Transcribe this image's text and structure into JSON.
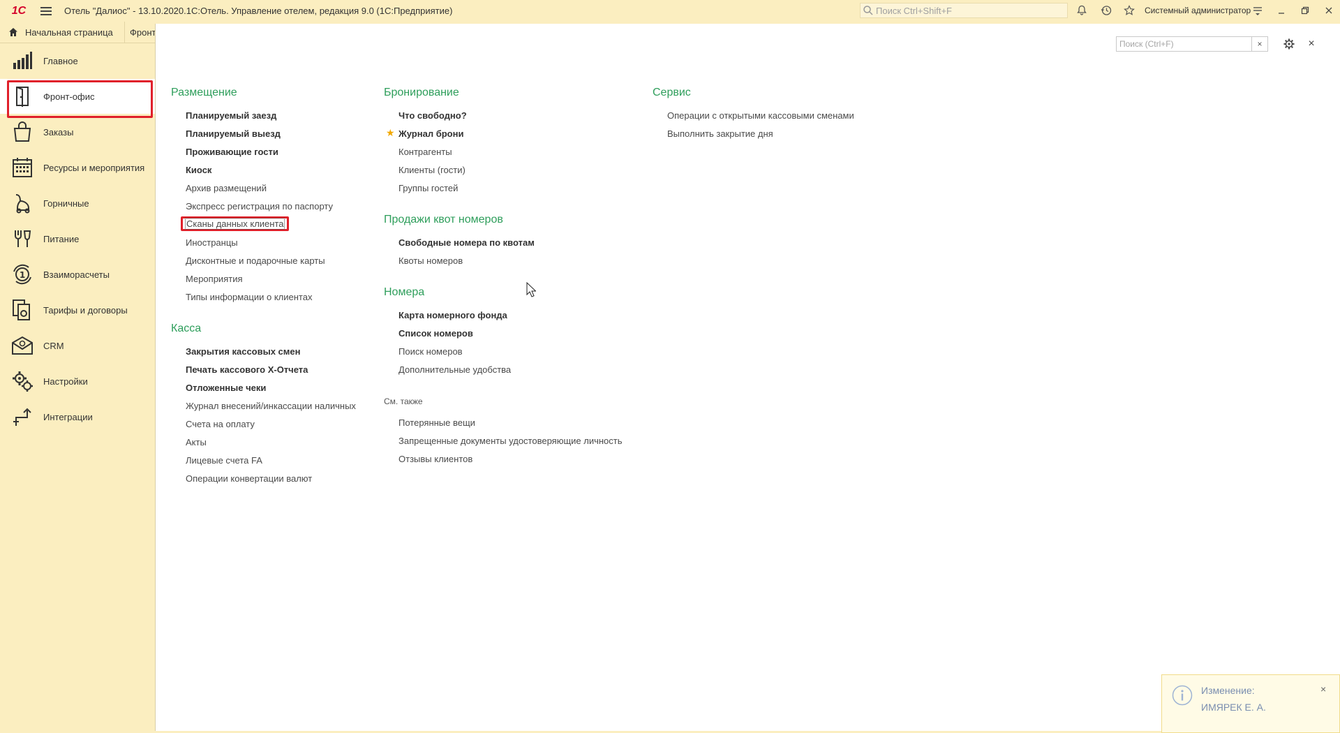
{
  "titlebar": {
    "logo": "1С",
    "title": "Отель \"Далиос\" - 13.10.2020.1С:Отель. Управление отелем, редакция 9.0  (1С:Предприятие)",
    "search_placeholder": "Поиск Ctrl+Shift+F",
    "user": "Системный администратор"
  },
  "tabs": {
    "home": "Начальная страница",
    "front": "Фронт-офис"
  },
  "sidebar": {
    "items": [
      {
        "label": "Главное",
        "icon": "bar-chart-icon"
      },
      {
        "label": "Фронт-офис",
        "icon": "door-icon",
        "active": true
      },
      {
        "label": "Заказы",
        "icon": "shopping-bag-icon"
      },
      {
        "label": "Ресурсы и мероприятия",
        "icon": "calendar-icon"
      },
      {
        "label": "Горничные",
        "icon": "vacuum-icon"
      },
      {
        "label": "Питание",
        "icon": "food-icon"
      },
      {
        "label": "Взаиморасчеты",
        "icon": "coin-cycle-icon"
      },
      {
        "label": "Тарифы и договоры",
        "icon": "documents-icon"
      },
      {
        "label": "CRM",
        "icon": "crm-mail-icon"
      },
      {
        "label": "Настройки",
        "icon": "settings-gears-icon"
      },
      {
        "label": "Интеграции",
        "icon": "integration-arrows-icon"
      }
    ]
  },
  "panel": {
    "search_placeholder": "Поиск (Ctrl+F)",
    "search_clear": "×",
    "close": "×"
  },
  "columns": {
    "placement": {
      "title": "Размещение",
      "items": [
        {
          "label": "Планируемый заезд",
          "bold": true
        },
        {
          "label": "Планируемый выезд",
          "bold": true
        },
        {
          "label": "Проживающие гости",
          "bold": true
        },
        {
          "label": "Киоск",
          "bold": true
        },
        {
          "label": "Архив размещений",
          "bold": false
        },
        {
          "label": "Экспресс регистрация по паспорту",
          "bold": false
        },
        {
          "label": "Сканы данных клиента",
          "bold": false,
          "highlighted": true
        },
        {
          "label": "Иностранцы",
          "bold": false
        },
        {
          "label": "Дисконтные и подарочные карты",
          "bold": false
        },
        {
          "label": "Мероприятия",
          "bold": false
        },
        {
          "label": "Типы информации о клиентах",
          "bold": false
        }
      ]
    },
    "cash": {
      "title": "Касса",
      "items": [
        {
          "label": "Закрытия кассовых смен",
          "bold": true
        },
        {
          "label": "Печать кассового X-Отчета",
          "bold": true
        },
        {
          "label": "Отложенные чеки",
          "bold": true
        },
        {
          "label": "Журнал внесений/инкассации наличных",
          "bold": false
        },
        {
          "label": "Счета на оплату",
          "bold": false
        },
        {
          "label": "Акты",
          "bold": false
        },
        {
          "label": "Лицевые счета FA",
          "bold": false
        },
        {
          "label": "Операции конвертации валют",
          "bold": false
        }
      ]
    },
    "booking": {
      "title": "Бронирование",
      "items": [
        {
          "label": "Что свободно?",
          "bold": true
        },
        {
          "label": "Журнал брони",
          "bold": true,
          "starred": true
        },
        {
          "label": "Контрагенты",
          "bold": false
        },
        {
          "label": "Клиенты (гости)",
          "bold": false
        },
        {
          "label": "Группы гостей",
          "bold": false
        }
      ]
    },
    "quota": {
      "title": "Продажи квот номеров",
      "items": [
        {
          "label": "Свободные номера по квотам",
          "bold": true
        },
        {
          "label": "Квоты номеров",
          "bold": false
        }
      ]
    },
    "rooms": {
      "title": "Номера",
      "items": [
        {
          "label": "Карта номерного фонда",
          "bold": true
        },
        {
          "label": "Список номеров",
          "bold": true
        },
        {
          "label": "Поиск номеров",
          "bold": false
        },
        {
          "label": "Дополнительные удобства",
          "bold": false
        }
      ]
    },
    "see_also": {
      "title": "См. также",
      "items": [
        {
          "label": "Потерянные вещи",
          "bold": false
        },
        {
          "label": "Запрещенные документы удостоверяющие личность",
          "bold": false
        },
        {
          "label": "Отзывы клиентов",
          "bold": false
        }
      ]
    },
    "service": {
      "title": "Сервис",
      "items": [
        {
          "label": "Операции с открытыми кассовыми сменами",
          "bold": false
        },
        {
          "label": "Выполнить закрытие дня",
          "bold": false
        }
      ]
    }
  },
  "notification": {
    "title": "Изменение:",
    "text": "ИМЯРЕК Е. А.",
    "close": "×"
  },
  "colors": {
    "background": "#fbeec0",
    "group_title": "#2e9e5b",
    "highlight": "#e0202a",
    "star": "#f2a800"
  }
}
